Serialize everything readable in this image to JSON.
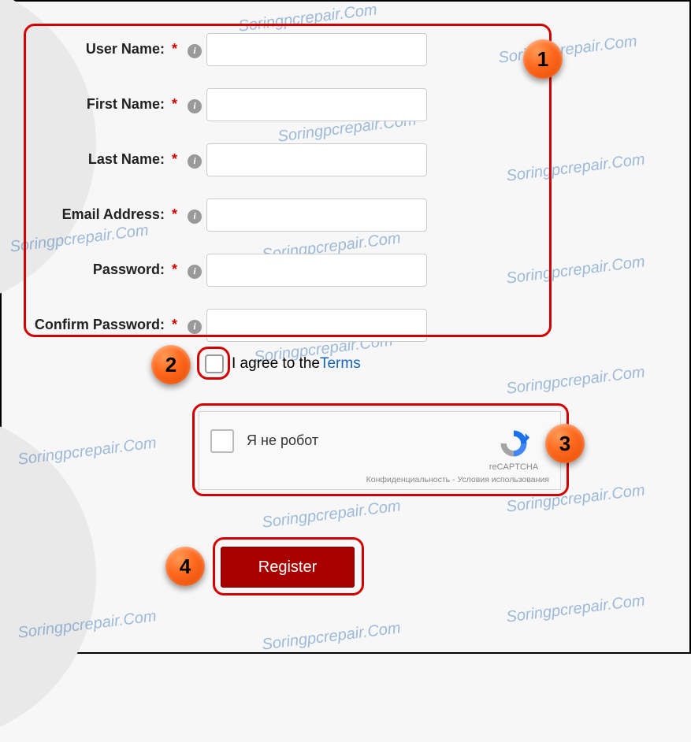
{
  "watermark": "Soringpcrepair.Com",
  "form": {
    "fields": [
      {
        "label": "User Name:"
      },
      {
        "label": "First Name:"
      },
      {
        "label": "Last Name:"
      },
      {
        "label": "Email Address:"
      },
      {
        "label": "Password:"
      },
      {
        "label": "Confirm Password:"
      }
    ],
    "required_mark": "*",
    "info_glyph": "i"
  },
  "terms": {
    "checkbox_checked": false,
    "text_prefix": "I agree to the ",
    "link_text": "Terms"
  },
  "captcha": {
    "label": "Я не робот",
    "brand": "reCAPTCHA",
    "footer": "Конфиденциальность - Условия использования"
  },
  "register_button": "Register",
  "annotations": {
    "b1": "1",
    "b2": "2",
    "b3": "3",
    "b4": "4"
  }
}
